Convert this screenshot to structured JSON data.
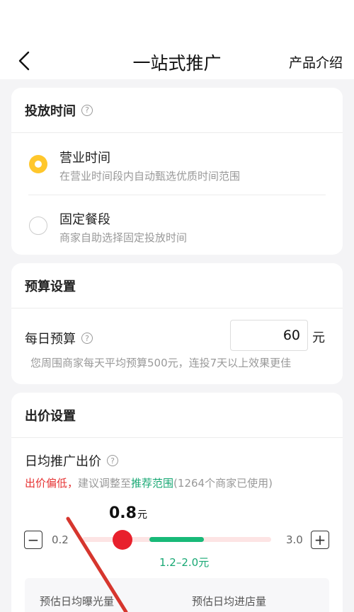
{
  "nav": {
    "title": "一站式推广",
    "right_label": "产品介绍"
  },
  "schedule": {
    "title": "投放时间",
    "options": [
      {
        "title": "营业时间",
        "desc": "在营业时间段内自动甄选优质时间范围",
        "selected": true
      },
      {
        "title": "固定餐段",
        "desc": "商家自助选择固定投放时间",
        "selected": false
      }
    ]
  },
  "budget": {
    "title": "预算设置",
    "daily_label": "每日预算",
    "value": "60",
    "unit": "元",
    "tip": "您周围商家每天平均预算500元，连投7天以上效果更佳"
  },
  "bid": {
    "title": "出价设置",
    "label": "日均推广出价",
    "tip_warn": "出价偏低，",
    "tip_mid": "建议调整至",
    "tip_link": "推荐范围",
    "tip_tail": "(1264个商家已使用)",
    "current": "0.8",
    "current_unit": "元",
    "min": "0.2",
    "max": "3.0",
    "minus": "−",
    "plus": "+",
    "range_label": "1.2–2.0元",
    "slider": {
      "min": 0.2,
      "max": 3.0,
      "value": 0.8,
      "range_low": 1.2,
      "range_high": 2.0
    },
    "estimates": [
      "预估日均曝光量",
      "预估日均进店量"
    ]
  },
  "colors": {
    "accent": "#ffc72c",
    "warn": "#e63232",
    "good": "#18a874",
    "thumb": "#e8202c"
  },
  "icons": {
    "back": "chevron-left-icon",
    "help": "question-circle-icon",
    "annotation": "red-arrow"
  }
}
